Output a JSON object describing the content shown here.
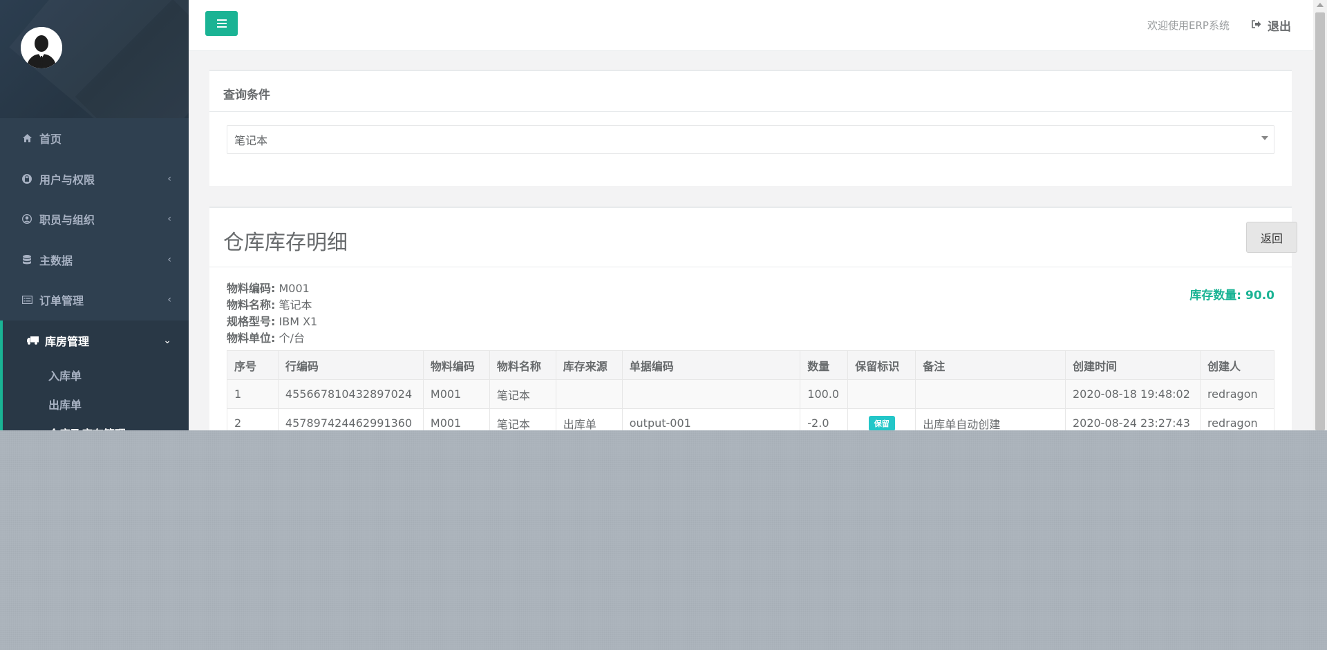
{
  "topbar": {
    "menu_icon": "bars-icon",
    "welcome": "欢迎使用ERP系统",
    "logout_icon": "sign-out-icon",
    "logout": "退出"
  },
  "sidebar": {
    "avatar_icon": "user-avatar",
    "items": [
      {
        "label": "首页",
        "icon": "home-icon"
      },
      {
        "label": "用户与权限",
        "icon": "lock-icon"
      },
      {
        "label": "职员与组织",
        "icon": "user-circle-icon"
      },
      {
        "label": "主数据",
        "icon": "database-icon"
      },
      {
        "label": "订单管理",
        "icon": "list-alt-icon"
      },
      {
        "label": "库房管理",
        "icon": "truck-icon"
      }
    ],
    "sub_items": [
      {
        "label": "入库单"
      },
      {
        "label": "出库单"
      },
      {
        "label": "仓库及库存管理"
      }
    ]
  },
  "query": {
    "title": "查询条件",
    "selected": "笔记本"
  },
  "detail": {
    "title": "仓库库存明细",
    "back": "返回",
    "material_code_label": "物料编码:",
    "material_code": "M001",
    "material_name_label": "物料名称:",
    "material_name": "笔记本",
    "spec_label": "规格型号:",
    "spec": "IBM X1",
    "unit_label": "物料单位:",
    "unit": "个/台",
    "stock_label": "库存数量:",
    "stock_value": "90.0"
  },
  "table": {
    "headers": [
      "序号",
      "行编码",
      "物料编码",
      "物料名称",
      "库存来源",
      "单据编码",
      "数量",
      "保留标识",
      "备注",
      "创建时间",
      "创建人"
    ],
    "rows": [
      {
        "no": "1",
        "line_code": "455667810432897024",
        "material_code": "M001",
        "material_name": "笔记本",
        "source": "",
        "doc_code": "",
        "qty": "100.0",
        "keep": "",
        "remark": "",
        "created": "2020-08-18 19:48:02",
        "creator": "redragon"
      },
      {
        "no": "2",
        "line_code": "457897424462991360",
        "material_code": "M001",
        "material_name": "笔记本",
        "source": "出库单",
        "doc_code": "output-001",
        "qty": "-2.0",
        "keep": "保留",
        "remark": "出库单自动创建",
        "created": "2020-08-24 23:27:43",
        "creator": "redragon"
      }
    ]
  },
  "colors": {
    "accent": "#1ab394",
    "sidebar": "#2f4050",
    "badge": "#23c6c8"
  }
}
